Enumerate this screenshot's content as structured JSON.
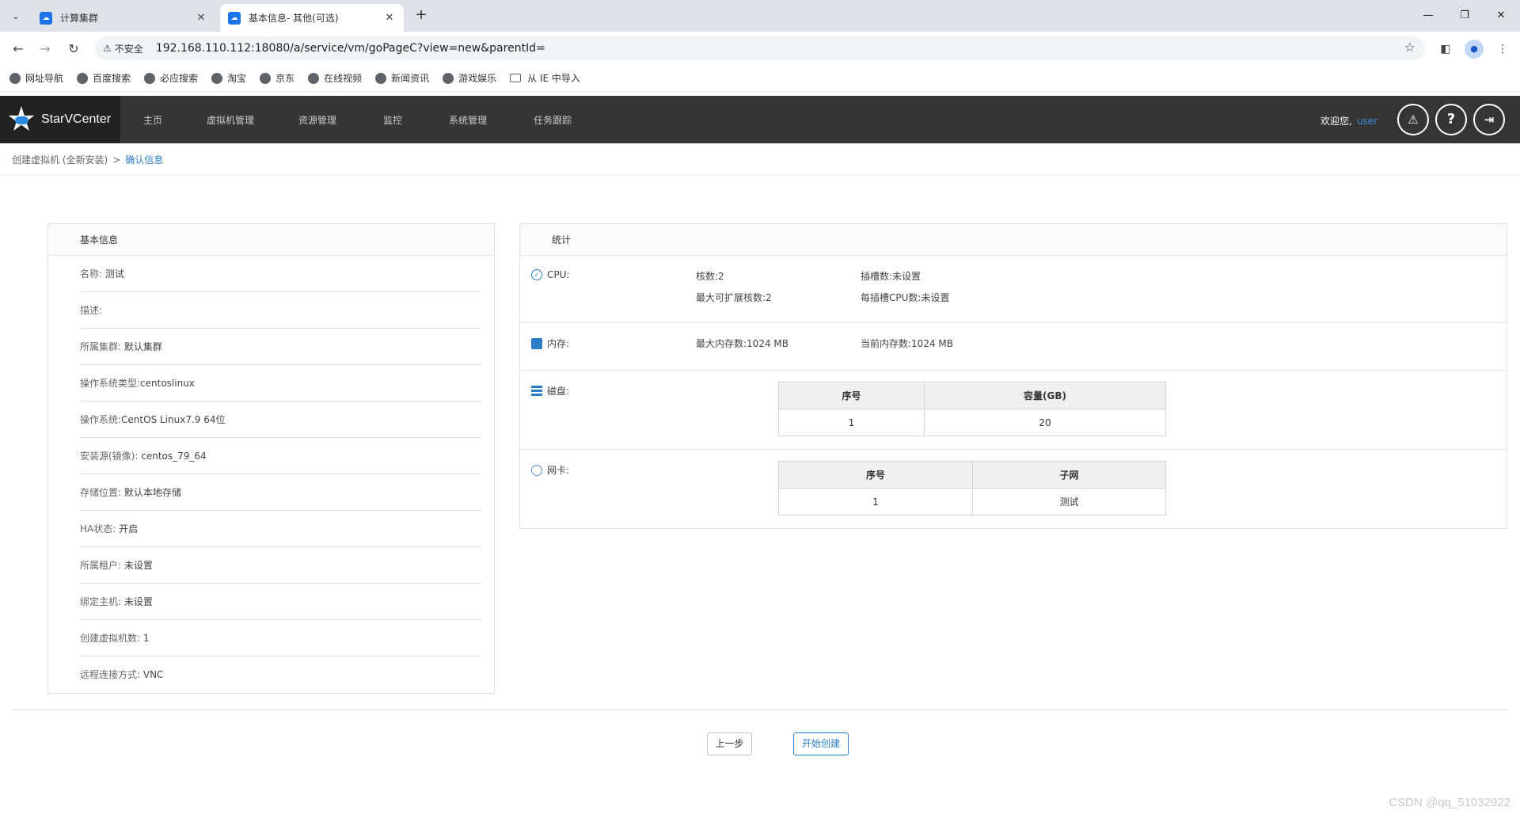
{
  "browser": {
    "tabs": [
      {
        "title": "计算集群",
        "active": false
      },
      {
        "title": "基本信息- 其他(可选)",
        "active": true
      }
    ],
    "address": {
      "security_label": "不安全",
      "url": "192.168.110.112:18080/a/service/vm/goPageC?view=new&parentId="
    },
    "bookmarks": [
      "网址导航",
      "百度搜索",
      "必应搜索",
      "淘宝",
      "京东",
      "在线视频",
      "新闻资讯",
      "游戏娱乐"
    ],
    "bookmark_folder": "从 IE 中导入"
  },
  "app": {
    "logo": "StarVCenter",
    "nav": [
      "主页",
      "虚拟机管理",
      "资源管理",
      "监控",
      "系统管理",
      "任务跟踪"
    ],
    "welcome": "欢迎您,",
    "user": "user",
    "colors": {
      "header": "#353535",
      "accent": "#2a7cc7"
    }
  },
  "breadcrumb": {
    "parent": "创建虚拟机 (全新安装)",
    "separator": ">",
    "current": "确认信息"
  },
  "basic_info": {
    "title": "基本信息",
    "rows": [
      {
        "label": "名称:",
        "value": "测试"
      },
      {
        "label": "描述:",
        "value": ""
      },
      {
        "label": "所属集群:",
        "value": "默认集群"
      },
      {
        "label": "操作系统类型:",
        "value": "centoslinux"
      },
      {
        "label": "操作系统:",
        "value": "CentOS Linux7.9 64位"
      },
      {
        "label": "安装源(镜像):",
        "value": "centos_79_64"
      },
      {
        "label": "存储位置:",
        "value": "默认本地存储"
      },
      {
        "label": "HA状态:",
        "value": "开启"
      },
      {
        "label": "所属租户:",
        "value": "未设置"
      },
      {
        "label": "绑定主机:",
        "value": "未设置"
      },
      {
        "label": "创建虚拟机数:",
        "value": "1"
      },
      {
        "label": "远程连接方式:",
        "value": "VNC"
      }
    ]
  },
  "stats": {
    "title": "统计",
    "cpu": {
      "label": "CPU:",
      "cores": "核数:2",
      "sockets": "插槽数:未设置",
      "max_cores": "最大可扩展核数:2",
      "cpu_per_socket": "每插槽CPU数:未设置"
    },
    "memory": {
      "label": "内存:",
      "max": "最大内存数:1024 MB",
      "current": "当前内存数:1024 MB"
    },
    "disk": {
      "label": "磁盘:",
      "headers": [
        "序号",
        "容量(GB)"
      ],
      "rows": [
        [
          "1",
          "20"
        ]
      ]
    },
    "nic": {
      "label": "网卡:",
      "headers": [
        "序号",
        "子网"
      ],
      "rows": [
        [
          "1",
          "测试"
        ]
      ]
    }
  },
  "actions": {
    "prev": "上一步",
    "create": "开始创建"
  },
  "watermark": "CSDN @qq_51032922"
}
